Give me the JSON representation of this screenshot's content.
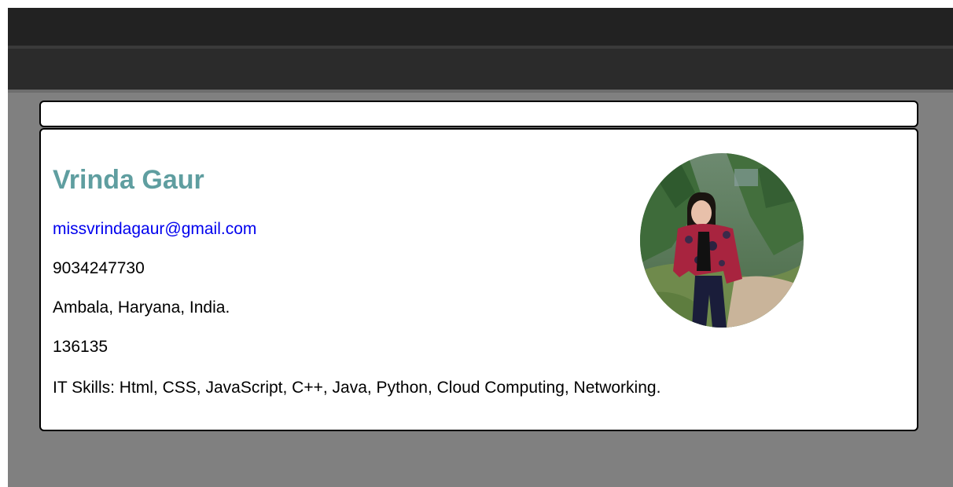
{
  "profile": {
    "name": "Vrinda Gaur",
    "email": "missvrindagaur@gmail.com",
    "phone": "9034247730",
    "address": "Ambala, Haryana, India.",
    "pincode": "136135",
    "skills": "IT Skills: Html, CSS, JavaScript, C++, Java, Python, Cloud Computing, Networking."
  },
  "colors": {
    "name_accent": "#5f9ea0",
    "link": "#0000ee",
    "page_background": "#808080",
    "header_dark": "#222222"
  }
}
